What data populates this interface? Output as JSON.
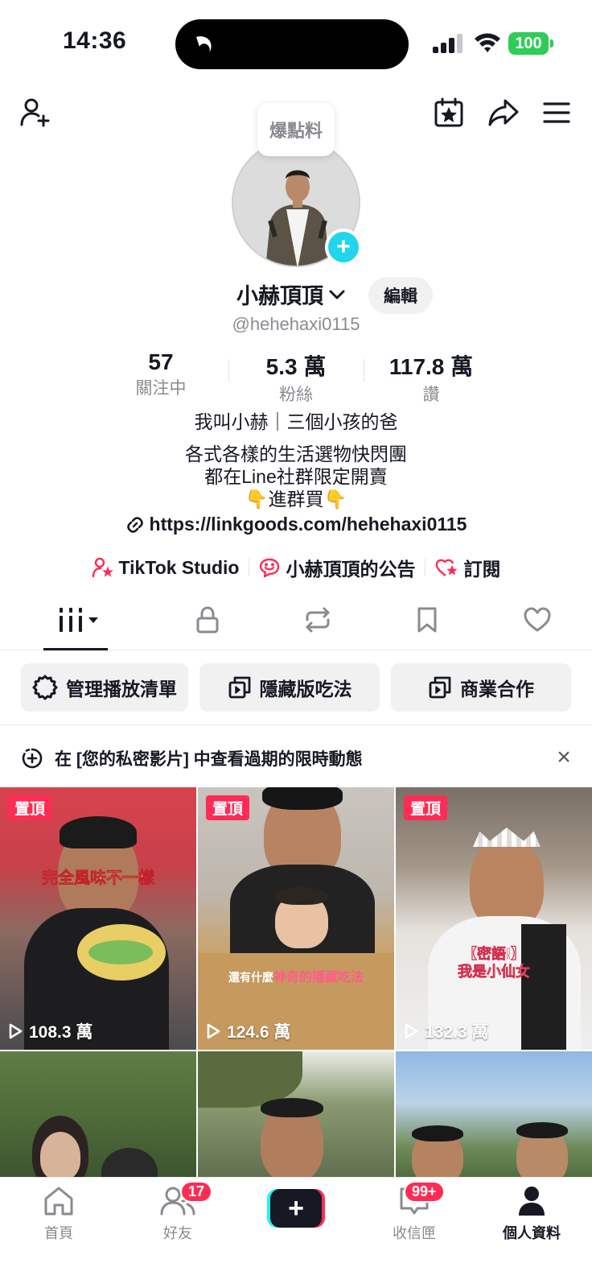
{
  "status_bar": {
    "time": "14:36",
    "battery": "100"
  },
  "profile": {
    "tip_bubble": "爆點料",
    "name": "小赫頂頂",
    "edit_label": "編輯",
    "handle": "@hehehaxi0115",
    "stats": [
      {
        "value": "57",
        "label": "關注中"
      },
      {
        "value": "5.3 萬",
        "label": "粉絲"
      },
      {
        "value": "117.8 萬",
        "label": "讚"
      }
    ],
    "bio_line1": "我叫小赫｜三個小孩的爸",
    "bio_line2": "各式各樣的生活選物快閃團",
    "bio_line3": "都在Line社群限定開賣",
    "bio_line4": "👇進群買👇",
    "link": "https://linkgoods.com/hehehaxi0115",
    "pills": [
      {
        "label": "TikTok Studio",
        "icon": "person-star-icon"
      },
      {
        "label": "小赫頂頂的公告",
        "icon": "chat-smile-icon"
      },
      {
        "label": "訂閱",
        "icon": "heart-star-icon"
      }
    ]
  },
  "tabs": [
    {
      "name": "videos-tab",
      "icon": "grid-bars-icon"
    },
    {
      "name": "private-tab",
      "icon": "lock-icon"
    },
    {
      "name": "reposts-tab",
      "icon": "repost-icon"
    },
    {
      "name": "favorites-tab",
      "icon": "bookmark-icon"
    },
    {
      "name": "liked-tab",
      "icon": "heart-icon"
    }
  ],
  "chips": [
    {
      "label": "管理播放清單",
      "icon": "gear-icon"
    },
    {
      "label": "隱藏版吃法",
      "icon": "playlist-icon"
    },
    {
      "label": "商業合作",
      "icon": "playlist-icon"
    }
  ],
  "banner": {
    "text": "在 [您的私密影片] 中查看過期的限時動態"
  },
  "videos": [
    {
      "pinned": "置頂",
      "views": "108.3 萬",
      "caption": "完全風味不一樣"
    },
    {
      "pinned": "置頂",
      "views": "124.6 萬",
      "caption_prefix": "還有什麼",
      "caption": "神奇的隱藏吃法"
    },
    {
      "pinned": "置頂",
      "views": "132.3 萬",
      "caption": "【密語!】",
      "caption2": "我是小仙女"
    },
    {},
    {},
    {}
  ],
  "nav": {
    "home": "首頁",
    "friends": "好友",
    "friends_badge": "17",
    "inbox": "收信匣",
    "inbox_badge": "99+",
    "me": "個人資料"
  },
  "colors": {
    "accent": "#fe2c55",
    "cyan": "#25f4ee",
    "plus_blue": "#20d5ec",
    "battery": "#2fcc57"
  }
}
